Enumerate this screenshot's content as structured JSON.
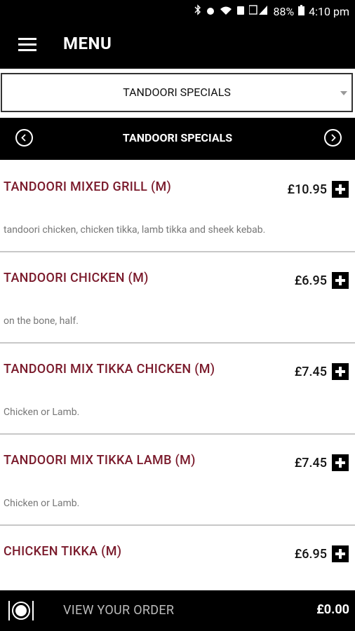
{
  "status_bar": {
    "battery": "88%",
    "time": "4:10 pm"
  },
  "app_bar": {
    "title": "MENU"
  },
  "dropdown": {
    "selected": "TANDOORI SPECIALS"
  },
  "category_bar": {
    "title": "TANDOORI SPECIALS"
  },
  "items": [
    {
      "name": "TANDOORI MIXED GRILL (M)",
      "price": "£10.95",
      "desc": "tandoori chicken, chicken tikka, lamb tikka and sheek kebab."
    },
    {
      "name": "TANDOORI CHICKEN (M)",
      "price": "£6.95",
      "desc": "on the bone, half."
    },
    {
      "name": "TANDOORI MIX TIKKA CHICKEN (M)",
      "price": "£7.45",
      "desc": "Chicken or Lamb."
    },
    {
      "name": "TANDOORI MIX TIKKA LAMB (M)",
      "price": "£7.45",
      "desc": "Chicken or Lamb."
    },
    {
      "name": "CHICKEN TIKKA (M)",
      "price": "£6.95",
      "desc": ""
    }
  ],
  "order_bar": {
    "label": "VIEW YOUR ORDER",
    "total": "£0.00"
  }
}
